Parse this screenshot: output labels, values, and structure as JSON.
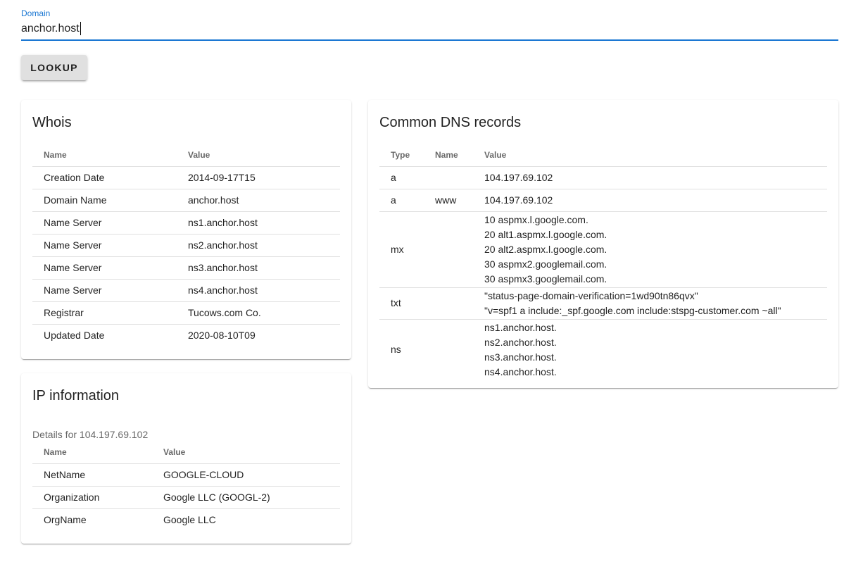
{
  "domain_field": {
    "label": "Domain",
    "value": "anchor.host"
  },
  "lookup_button": {
    "label": "Lookup"
  },
  "whois": {
    "title": "Whois",
    "columns": [
      "Name",
      "Value"
    ],
    "rows": [
      {
        "name": "Creation Date",
        "value": "2014-09-17T15"
      },
      {
        "name": "Domain Name",
        "value": "anchor.host"
      },
      {
        "name": "Name Server",
        "value": "ns1.anchor.host"
      },
      {
        "name": "Name Server",
        "value": "ns2.anchor.host"
      },
      {
        "name": "Name Server",
        "value": "ns3.anchor.host"
      },
      {
        "name": "Name Server",
        "value": "ns4.anchor.host"
      },
      {
        "name": "Registrar",
        "value": "Tucows.com Co."
      },
      {
        "name": "Updated Date",
        "value": "2020-08-10T09"
      }
    ]
  },
  "ip_info": {
    "title": "IP information",
    "subtitle": "Details for 104.197.69.102",
    "columns": [
      "Name",
      "Value"
    ],
    "rows": [
      {
        "name": "NetName",
        "value": "GOOGLE-CLOUD"
      },
      {
        "name": "Organization",
        "value": "Google LLC (GOOGL-2)"
      },
      {
        "name": "OrgName",
        "value": "Google LLC"
      }
    ]
  },
  "dns": {
    "title": "Common DNS records",
    "columns": [
      "Type",
      "Name",
      "Value"
    ],
    "rows": [
      {
        "type": "a",
        "name": "",
        "values": [
          "104.197.69.102"
        ]
      },
      {
        "type": "a",
        "name": "www",
        "values": [
          "104.197.69.102"
        ]
      },
      {
        "type": "mx",
        "name": "",
        "values": [
          "10 aspmx.l.google.com.",
          "20 alt1.aspmx.l.google.com.",
          "20 alt2.aspmx.l.google.com.",
          "30 aspmx2.googlemail.com.",
          "30 aspmx3.googlemail.com."
        ]
      },
      {
        "type": "txt",
        "name": "",
        "values": [
          "\"status-page-domain-verification=1wd90tn86qvx\"",
          "\"v=spf1 a include:_spf.google.com include:stspg-customer.com ~all\""
        ]
      },
      {
        "type": "ns",
        "name": "",
        "values": [
          "ns1.anchor.host.",
          "ns2.anchor.host.",
          "ns3.anchor.host.",
          "ns4.anchor.host."
        ]
      }
    ]
  }
}
